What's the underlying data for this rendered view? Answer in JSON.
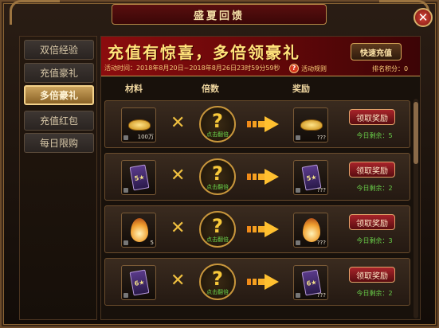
{
  "window": {
    "title": "盛夏回馈"
  },
  "sidebar": {
    "items": [
      {
        "label": "双倍经验"
      },
      {
        "label": "充值豪礼"
      },
      {
        "label": "多倍豪礼",
        "active": true
      },
      {
        "label": "充值红包"
      },
      {
        "label": "每日限购"
      }
    ]
  },
  "banner": {
    "headline": "充值有惊喜，多倍领豪礼",
    "time": "活动时间：2018年8月20日~2018年8月26日23时59分59秒",
    "rules_label": "活动规则",
    "score": "排名积分：0",
    "quick_button": "快速充值"
  },
  "columns": {
    "material": "材料",
    "multiplier": "倍数",
    "reward": "奖励"
  },
  "rows": [
    {
      "material_icon": "gold-ingot-icon",
      "material_qty": "100万",
      "reward_icon": "gold-ingot-icon",
      "reward_qty": "???",
      "mystery_hint": "点击翻倍",
      "button": "领取奖励",
      "remaining": "今日剩余：5"
    },
    {
      "material_icon": "card-5-star-icon",
      "material_qty": "",
      "material_card": "5★",
      "reward_icon": "card-5-star-icon",
      "reward_card": "5★",
      "reward_qty": "???",
      "mystery_hint": "点击翻倍",
      "button": "领取奖励",
      "remaining": "今日剩余：2"
    },
    {
      "material_icon": "flame-orb-icon",
      "material_qty": "5",
      "reward_icon": "flame-orb-icon",
      "reward_qty": "???",
      "mystery_hint": "点击翻倍",
      "button": "领取奖励",
      "remaining": "今日剩余：3"
    },
    {
      "material_icon": "card-6-star-icon",
      "material_qty": "",
      "material_card": "6★",
      "reward_icon": "card-6-star-icon",
      "reward_card": "6★",
      "reward_qty": "???",
      "mystery_hint": "点击翻倍",
      "button": "领取奖励",
      "remaining": "今日剩余：2"
    }
  ],
  "symbols": {
    "times": "✕",
    "question": "?"
  }
}
